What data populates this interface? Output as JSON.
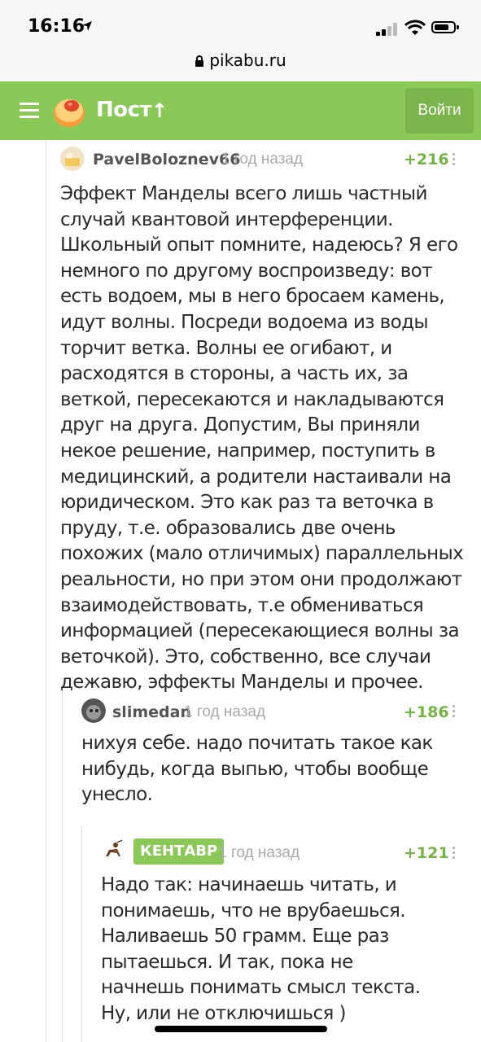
{
  "status_bar": {
    "time": "16:16"
  },
  "browser": {
    "url": "pikabu.ru"
  },
  "header": {
    "title": "Пост",
    "login_label": "Войти"
  },
  "comments": [
    {
      "user": "PavelBoloznev66",
      "time": "1 год назад",
      "rating": "+216",
      "text": "Эффект Манделы всего лишь частный случай квантовой интерференции. Школьный опыт помните, надеюсь? Я его немного по другому воспроизведу: вот есть водоем, мы в него бросаем камень, идут волны. Посреди водоема из воды торчит ветка. Волны ее огибают, и расходятся в стороны, а часть их, за веткой, пересекаются и накладываются друг на друга. Допустим, Вы приняли некое решение, например, поступить в медицинский, а родители настаивали на юридическом. Это как раз та веточка в пруду, т.е. образовались две очень похожих (мало отличимых) параллельных реальности, но при этом они продолжают взаимодействовать, т.е обмениваться информацией (пересекающиеся волны за веточкой). Это, собственно, все случаи дежавю, эффекты Манделы и прочее."
    },
    {
      "user": "slimedan",
      "time": "1 год назад",
      "rating": "+186",
      "text": "нихуя себе. надо почитать такое как нибудь, когда выпью, чтобы вообще унесло."
    },
    {
      "user": "КЕНТАВР",
      "time": "1 год назад",
      "rating": "+121",
      "text": "Надо так: начинаешь читать, и понимаешь, что не врубаешься. Наливаешь 50 грамм. Еще раз пытаешься. И так, пока не начнешь понимать смысл текста. Ну, или не отключишься )"
    }
  ],
  "colors": {
    "accent": "#8ac858",
    "rating": "#74b444"
  },
  "icons": [
    "location-arrow-icon",
    "signal-icon",
    "wifi-icon",
    "battery-icon",
    "lock-icon",
    "menu-icon",
    "pikabu-logo",
    "arrow-up-icon",
    "more-vertical-icon"
  ]
}
